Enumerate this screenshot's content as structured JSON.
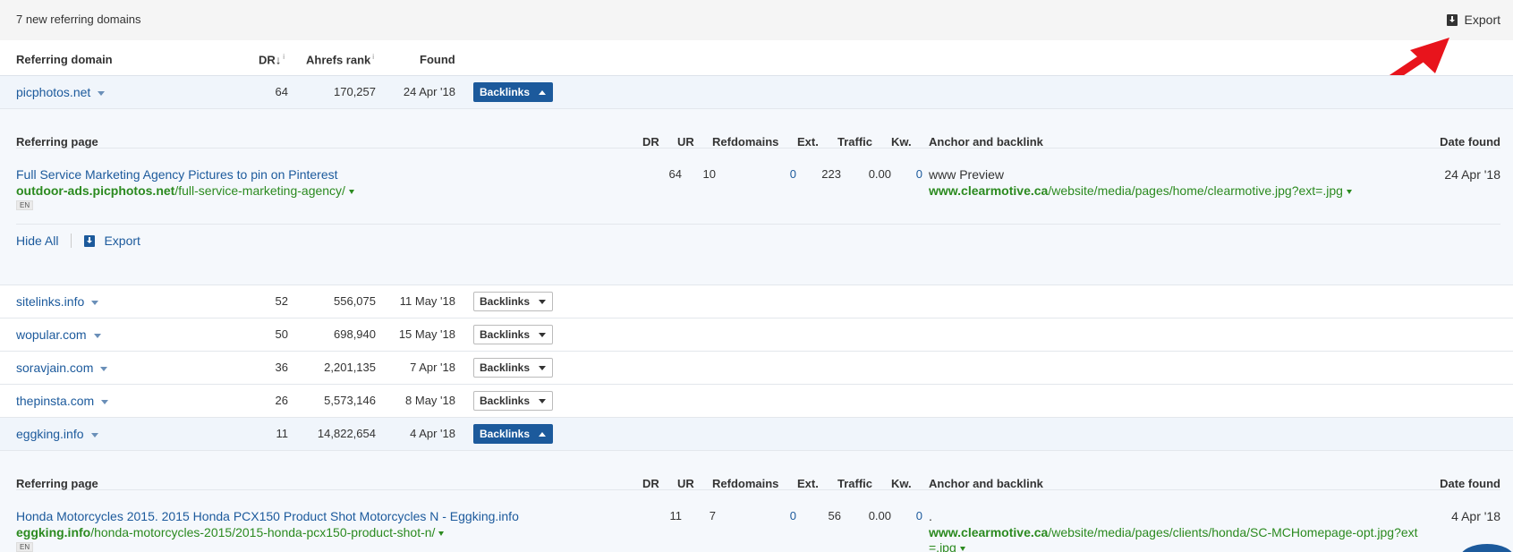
{
  "top": {
    "count_text": "7 new referring domains",
    "export_label": "Export"
  },
  "header": {
    "domain": "Referring domain",
    "dr": "DR",
    "dr_sort": "↓",
    "dr_info": "i",
    "ahrefs_rank": "Ahrefs rank",
    "ahrefs_info": "i",
    "found": "Found"
  },
  "backlinks_label": "Backlinks",
  "rows": [
    {
      "domain": "picphotos.net",
      "dr": "64",
      "rank": "170,257",
      "found": "24 Apr '18"
    },
    {
      "domain": "sitelinks.info",
      "dr": "52",
      "rank": "556,075",
      "found": "11 May '18"
    },
    {
      "domain": "wopular.com",
      "dr": "50",
      "rank": "698,940",
      "found": "15 May '18"
    },
    {
      "domain": "soravjain.com",
      "dr": "36",
      "rank": "2,201,135",
      "found": "7 Apr '18"
    },
    {
      "domain": "thepinsta.com",
      "dr": "26",
      "rank": "5,573,146",
      "found": "8 May '18"
    },
    {
      "domain": "eggking.info",
      "dr": "11",
      "rank": "14,822,654",
      "found": "4 Apr '18"
    }
  ],
  "sub_header": {
    "page": "Referring page",
    "dr": "DR",
    "ur": "UR",
    "refdomains": "Refdomains",
    "ext": "Ext.",
    "traffic": "Traffic",
    "kw": "Kw.",
    "anchor": "Anchor and backlink",
    "date": "Date found"
  },
  "detail1": {
    "title": "Full Service Marketing Agency Pictures to pin on Pinterest",
    "url_bold": "outdoor-ads.picphotos.net",
    "url_rest": "/full-service-marketing-agency/",
    "lang": "EN",
    "dr": "64",
    "ur": "10",
    "refdomains": "0",
    "ext": "223",
    "traffic": "0.00",
    "kw": "0",
    "anchor": "www Preview",
    "link_bold": "www.clearmotive.ca",
    "link_rest": "/website/media/pages/home/clearmotive.jpg?ext=.jpg",
    "date": "24 Apr '18"
  },
  "actions": {
    "hide_all": "Hide All",
    "export": "Export"
  },
  "detail2": {
    "title": "Honda Motorcycles 2015. 2015 Honda PCX150 Product Shot Motorcycles N - Eggking.info",
    "url_bold": "eggking.info",
    "url_rest": "/honda-motorcycles-2015/2015-honda-pcx150-product-shot-n/",
    "lang": "EN",
    "dr": "11",
    "ur": "7",
    "refdomains": "0",
    "ext": "56",
    "traffic": "0.00",
    "kw": "0",
    "anchor": ".",
    "link_bold": "www.clearmotive.ca",
    "link_rest_1": "/website/media/pages/clients/honda/SC-MCHomepage-opt.jpg?ext",
    "link_rest_2": "=.jpg",
    "date": "4 Apr '18"
  },
  "colors": {
    "link_blue": "#1c5a9c",
    "url_green": "#2b8a1f",
    "arrow_red": "#e8141c"
  }
}
